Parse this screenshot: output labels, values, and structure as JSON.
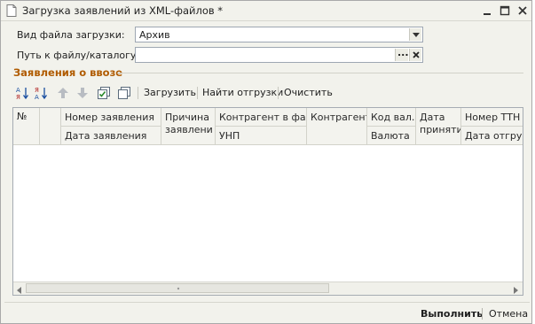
{
  "window": {
    "title": "Загрузка заявлений из XML-файлов *"
  },
  "form": {
    "file_type_label": "Вид файла загрузки:",
    "file_type_value": "Архив",
    "path_label": "Путь к файлу/каталогу:",
    "path_value": "",
    "browse_label": "..."
  },
  "section": {
    "title": "Заявления о ввозе"
  },
  "toolbar": {
    "load": "Загрузить",
    "find_shipments": "Найти отгрузки",
    "clear": "Очистить"
  },
  "table": {
    "columns_top": [
      "№",
      "Номер заявления",
      "Причина заявлени",
      "Контрагент в фа...",
      "Контрагент",
      "Код вал...",
      "Дата приняти",
      "Номер ТТН"
    ],
    "columns_bottom": [
      "Дата заявления",
      "УНП",
      "Валюта",
      "Дата отгруз..."
    ],
    "rows": []
  },
  "footer": {
    "execute": "Выполнить",
    "cancel": "Отмена"
  },
  "colors": {
    "section_title": "#b05b00",
    "window_bg": "#f2f2ec"
  }
}
